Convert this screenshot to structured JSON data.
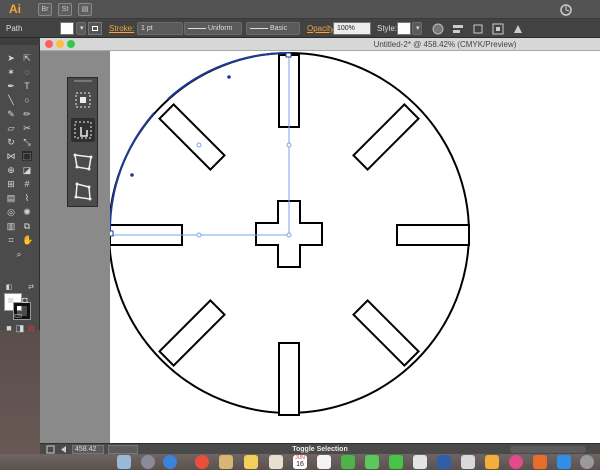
{
  "app": {
    "logo_text": "Ai"
  },
  "control_bar": {
    "selection_type": "Path",
    "stroke_label": "Stroke:",
    "stroke_weight": "1 pt",
    "profile_uniform": "Uniform",
    "brush_basic": "Basic",
    "opacity_label": "Opacity:",
    "opacity_value": "100%",
    "style_label": "Style:"
  },
  "document": {
    "title": "Untitled-2* @ 458.42% (CMYK/Preview)"
  },
  "status_bar": {
    "zoom": "458.42",
    "message": "Toggle Selection"
  },
  "calendar_icon": {
    "month": "JUN",
    "day": "16"
  },
  "colors": {
    "accent_orange": "#f7a33a",
    "selection_blue": "#1f3a93",
    "canvas": "#ffffff",
    "panel_dark": "#4b4b4b"
  },
  "shape_builder_panel": {
    "icons": [
      "align-nodes-icon",
      "hand-nodes-icon",
      "transform-shape-icon",
      "shape-nodes-icon"
    ]
  }
}
